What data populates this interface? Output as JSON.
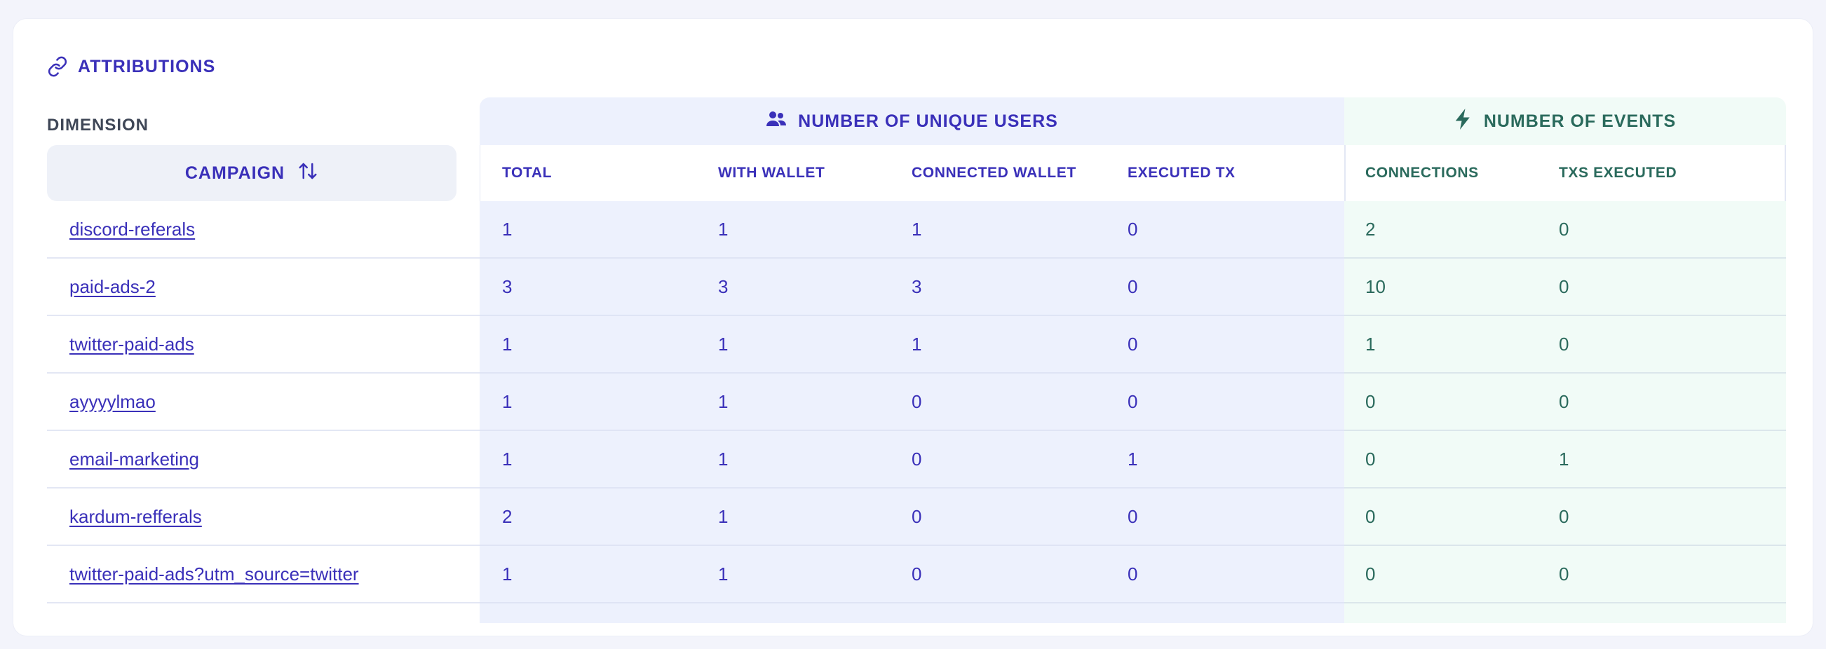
{
  "header": {
    "title": "ATTRIBUTIONS",
    "icon": "link-icon"
  },
  "dimension": {
    "label": "DIMENSION",
    "sort_button": {
      "label": "CAMPAIGN",
      "icon": "sort-arrows-icon"
    }
  },
  "groups": {
    "users": {
      "label": "NUMBER OF UNIQUE USERS",
      "icon": "users-icon",
      "color": "#3a30b9"
    },
    "events": {
      "label": "NUMBER OF EVENTS",
      "icon": "bolt-icon",
      "color": "#2a6a5c"
    }
  },
  "columns": {
    "users": [
      "TOTAL",
      "WITH WALLET",
      "CONNECTED WALLET",
      "EXECUTED TX"
    ],
    "events": [
      "CONNECTIONS",
      "TXS EXECUTED"
    ]
  },
  "rows": [
    {
      "campaign": "discord-referals",
      "users": [
        "1",
        "1",
        "1",
        "0"
      ],
      "events": [
        "2",
        "0"
      ]
    },
    {
      "campaign": "paid-ads-2",
      "users": [
        "3",
        "3",
        "3",
        "0"
      ],
      "events": [
        "10",
        "0"
      ]
    },
    {
      "campaign": "twitter-paid-ads",
      "users": [
        "1",
        "1",
        "1",
        "0"
      ],
      "events": [
        "1",
        "0"
      ]
    },
    {
      "campaign": "ayyyylmao",
      "users": [
        "1",
        "1",
        "0",
        "0"
      ],
      "events": [
        "0",
        "0"
      ]
    },
    {
      "campaign": "email-marketing",
      "users": [
        "1",
        "1",
        "0",
        "1"
      ],
      "events": [
        "0",
        "1"
      ]
    },
    {
      "campaign": "kardum-refferals",
      "users": [
        "2",
        "1",
        "0",
        "0"
      ],
      "events": [
        "0",
        "0"
      ]
    },
    {
      "campaign": "twitter-paid-ads?utm_source=twitter",
      "users": [
        "1",
        "1",
        "0",
        "0"
      ],
      "events": [
        "0",
        "0"
      ]
    }
  ]
}
